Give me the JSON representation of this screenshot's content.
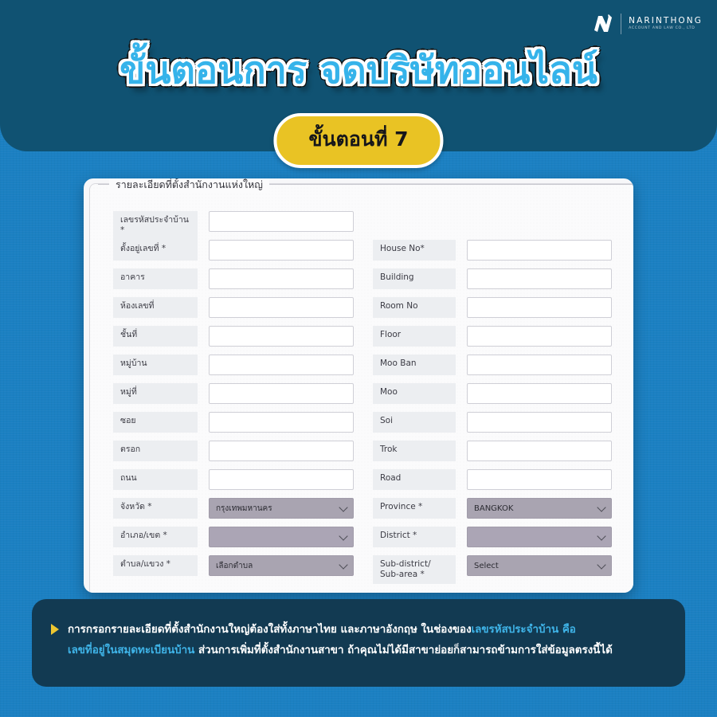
{
  "header": {
    "title": "ขั้นตอนการ จดบริษัทออนไลน์",
    "step_badge": "ขั้นตอนที่ 7",
    "logo": {
      "name": "NARINTHONG",
      "subtitle": "ACCOUNT AND LAW CO., LTD",
      "mark_icon": "narinthong-n-logo-icon"
    },
    "colors": {
      "header_bg": "#105272",
      "page_bg": "#1b80c2",
      "badge_bg": "#e9c324",
      "title_fill": "#35b3ea"
    }
  },
  "form": {
    "legend": "รายละเอียดที่ตั้งสำนักงานแห่งใหญ่",
    "thai_fields": [
      {
        "label": "เลขรหัสประจำบ้าน *",
        "type": "text",
        "value": ""
      },
      {
        "label": "ตั้งอยู่เลขที่ *",
        "type": "text",
        "value": ""
      },
      {
        "label": "อาคาร",
        "type": "text",
        "value": ""
      },
      {
        "label": "ห้องเลขที่",
        "type": "text",
        "value": ""
      },
      {
        "label": "ชั้นที่",
        "type": "text",
        "value": ""
      },
      {
        "label": "หมู่บ้าน",
        "type": "text",
        "value": ""
      },
      {
        "label": "หมู่ที่",
        "type": "text",
        "value": ""
      },
      {
        "label": "ซอย",
        "type": "text",
        "value": ""
      },
      {
        "label": "ตรอก",
        "type": "text",
        "value": ""
      },
      {
        "label": "ถนน",
        "type": "text",
        "value": ""
      },
      {
        "label": "จังหวัด *",
        "type": "select",
        "value": "กรุงเทพมหานคร"
      },
      {
        "label": "อำเภอ/เขต *",
        "type": "select",
        "value": ""
      },
      {
        "label": "ตำบล/แขวง *",
        "type": "select",
        "value": "เลือกตำบล"
      }
    ],
    "english_fields": [
      {
        "label": "House No*",
        "type": "text",
        "value": ""
      },
      {
        "label": "Building",
        "type": "text",
        "value": ""
      },
      {
        "label": "Room No",
        "type": "text",
        "value": ""
      },
      {
        "label": "Floor",
        "type": "text",
        "value": ""
      },
      {
        "label": "Moo Ban",
        "type": "text",
        "value": ""
      },
      {
        "label": "Moo",
        "type": "text",
        "value": ""
      },
      {
        "label": "Soi",
        "type": "text",
        "value": ""
      },
      {
        "label": "Trok",
        "type": "text",
        "value": ""
      },
      {
        "label": "Road",
        "type": "text",
        "value": ""
      },
      {
        "label": "Province *",
        "type": "select",
        "value": "BANGKOK"
      },
      {
        "label": "District *",
        "type": "select",
        "value": ""
      },
      {
        "label": "Sub-district/ Sub-area *",
        "type": "select",
        "value": "Select"
      }
    ]
  },
  "note": {
    "arrow_icon": "triangle-right-icon",
    "line1_a": "การกรอกรายละเอียดที่ตั้งสำนักงานใหญ่ต้องใส่ทั้งภาษาไทย และภาษาอังกฤษ ในช่องของ",
    "line1_hl": "เลขรหัสประจำบ้าน คือ",
    "line2_hl": "เลขที่อยู่ในสมุดทะเบียนบ้าน",
    "line2_b": " ส่วนการเพิ่มที่ตั้งสำนักงานสาขา ถ้าคุณไม่ได้มีสาขาย่อยก็สามารถข้ามการใส่ข้อมูลตรงนี้ได้",
    "highlight_color": "#3fb4e8"
  }
}
